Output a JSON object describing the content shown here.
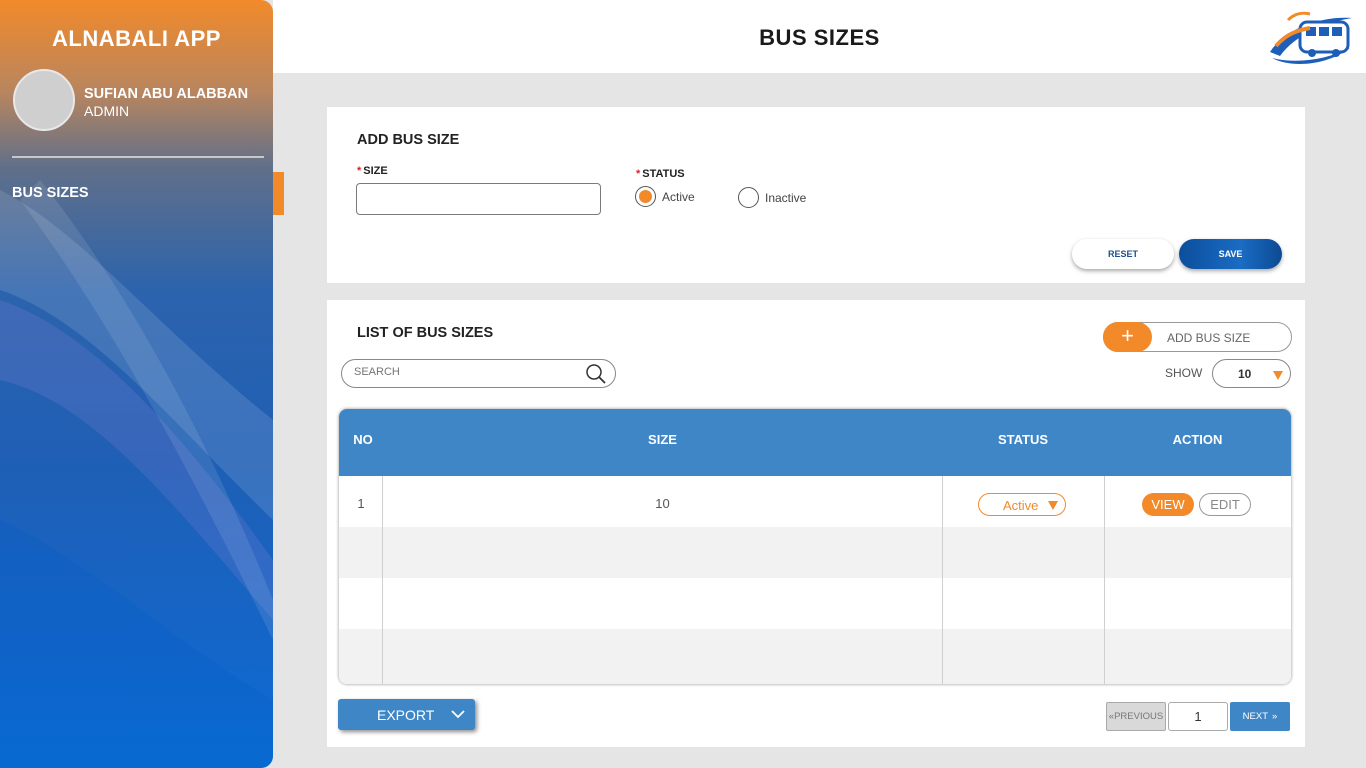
{
  "sidebar": {
    "app_title": "ALNABALI APP",
    "user_name": "SUFIAN ABU ALABBAN",
    "user_role": "ADMIN",
    "nav_items": [
      {
        "label": "BUS SIZES",
        "active": true
      }
    ]
  },
  "header": {
    "title": "BUS SIZES",
    "logo_icon": "bus-logo-icon"
  },
  "form": {
    "title": "ADD BUS SIZE",
    "size_label": "SIZE",
    "size_value": "",
    "status_label": "STATUS",
    "required_mark": "*",
    "status_options": [
      {
        "label": "Active",
        "selected": true
      },
      {
        "label": "Inactive",
        "selected": false
      }
    ],
    "reset_label": "RESET",
    "save_label": "SAVE"
  },
  "list": {
    "title": "LIST OF BUS SIZES",
    "add_button_label": "ADD BUS SIZE",
    "search_placeholder": "SEARCH",
    "show_label": "SHOW",
    "show_value": "10",
    "columns": [
      "NO",
      "SIZE",
      "STATUS",
      "ACTION"
    ],
    "rows": [
      {
        "no": "1",
        "size": "10",
        "status": "Active",
        "view_label": "VIEW",
        "edit_label": "EDIT"
      }
    ],
    "export_label": "EXPORT",
    "previous_label": "PREVIOUS",
    "page_value": "1",
    "next_label": "NEXT"
  },
  "colors": {
    "accent_orange": "#f28a2a",
    "primary_blue": "#3f86c7",
    "save_blue": "#0c4e9c"
  }
}
